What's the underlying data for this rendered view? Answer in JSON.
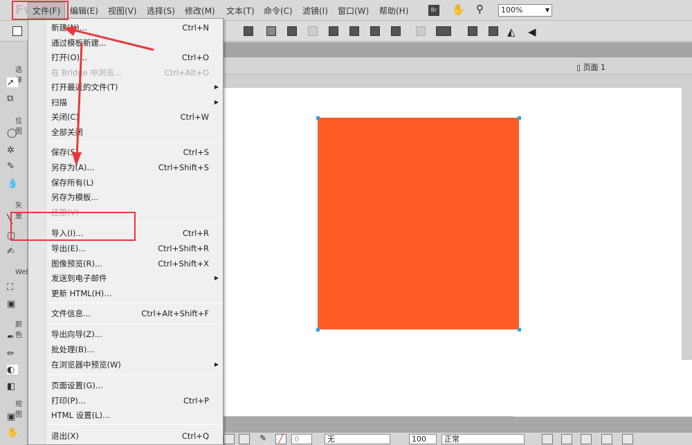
{
  "menubar": {
    "logo": "Fw",
    "items": [
      "文件(F)",
      "编辑(E)",
      "视图(V)",
      "选择(S)",
      "修改(M)",
      "文本(T)",
      "命令(C)",
      "滤镜(I)",
      "窗口(W)",
      "帮助(H)"
    ],
    "bridge_label": "Br",
    "zoom_value": "100%"
  },
  "document": {
    "page_tab": "页面 1",
    "shape_color": "#ff5c26"
  },
  "left_panel": {
    "sections": [
      "选择",
      "位图",
      "矢量",
      "Web",
      "颜色",
      "视图"
    ]
  },
  "file_menu": {
    "items": [
      {
        "label": "新建(N)...",
        "shortcut": "Ctrl+N"
      },
      {
        "label": "通过模板新建...",
        "shortcut": ""
      },
      {
        "label": "打开(O)...",
        "shortcut": "Ctrl+O"
      },
      {
        "label": "在 Bridge 中浏览...",
        "shortcut": "Ctrl+Alt+O",
        "disabled": true
      },
      {
        "label": "打开最近的文件(T)",
        "shortcut": "",
        "submenu": true
      },
      {
        "label": "扫描",
        "shortcut": "",
        "submenu": true
      },
      {
        "label": "关闭(C)",
        "shortcut": "Ctrl+W"
      },
      {
        "label": "全部关闭",
        "shortcut": ""
      },
      {
        "label": "保存(S)",
        "shortcut": "Ctrl+S"
      },
      {
        "label": "另存为(A)...",
        "shortcut": "Ctrl+Shift+S"
      },
      {
        "label": "保存所有(L)",
        "shortcut": ""
      },
      {
        "label": "另存为模板...",
        "shortcut": ""
      },
      {
        "label": "还原(V)",
        "shortcut": "",
        "disabled": true
      },
      {
        "label": "导入(I)...",
        "shortcut": "Ctrl+R"
      },
      {
        "label": "导出(E)...",
        "shortcut": "Ctrl+Shift+R"
      },
      {
        "label": "图像预览(R)...",
        "shortcut": "Ctrl+Shift+X"
      },
      {
        "label": "发送到电子邮件",
        "shortcut": "",
        "submenu": true
      },
      {
        "label": "更新 HTML(H)...",
        "shortcut": ""
      },
      {
        "label": "文件信息...",
        "shortcut": "Ctrl+Alt+Shift+F"
      },
      {
        "label": "导出向导(Z)...",
        "shortcut": ""
      },
      {
        "label": "批处理(B)...",
        "shortcut": ""
      },
      {
        "label": "在浏览器中预览(W)",
        "shortcut": "",
        "submenu": true
      },
      {
        "label": "页面设置(G)...",
        "shortcut": ""
      },
      {
        "label": "打印(P)...",
        "shortcut": "Ctrl+P"
      },
      {
        "label": "HTML 设置(L)...",
        "shortcut": ""
      },
      {
        "label": "退出(X)",
        "shortcut": "Ctrl+Q"
      }
    ]
  },
  "properties": {
    "stroke_size": "0",
    "stroke_type": "无",
    "opacity": "100",
    "blend_mode": "正常"
  },
  "annotation_color": "#e8373a"
}
